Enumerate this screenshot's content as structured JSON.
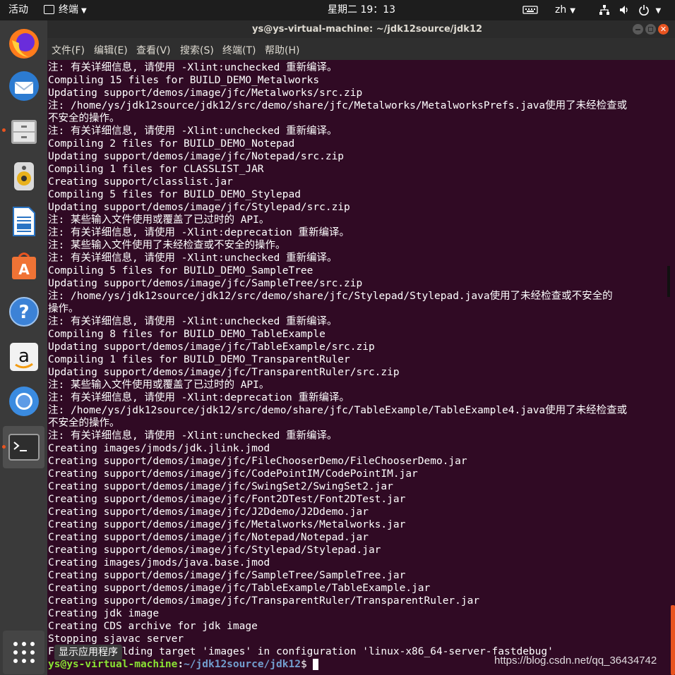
{
  "topbar": {
    "activities": "活动",
    "app_menu": "终端",
    "clock": "星期二 19：13",
    "lang": "zh"
  },
  "dock": {
    "show_apps_tooltip": "显示应用程序",
    "items": [
      "firefox-icon",
      "thunderbird-icon",
      "files-icon",
      "rhythmbox-icon",
      "libreoffice-writer-icon",
      "software-center-icon",
      "help-icon",
      "amazon-icon",
      "chromium-icon",
      "terminal-icon"
    ]
  },
  "window": {
    "title": "ys@ys-virtual-machine: ~/jdk12source/jdk12"
  },
  "menubar": [
    "文件(F)",
    "编辑(E)",
    "查看(V)",
    "搜索(S)",
    "终端(T)",
    "帮助(H)"
  ],
  "terminal": {
    "lines": [
      "注: 有关详细信息, 请使用 -Xlint:unchecked 重新编译。",
      "Compiling 15 files for BUILD_DEMO_Metalworks",
      "Updating support/demos/image/jfc/Metalworks/src.zip",
      "注: /home/ys/jdk12source/jdk12/src/demo/share/jfc/Metalworks/MetalworksPrefs.java使用了未经检查或",
      "不安全的操作。",
      "注: 有关详细信息, 请使用 -Xlint:unchecked 重新编译。",
      "Compiling 2 files for BUILD_DEMO_Notepad",
      "Updating support/demos/image/jfc/Notepad/src.zip",
      "Compiling 1 files for CLASSLIST_JAR",
      "Creating support/classlist.jar",
      "Compiling 5 files for BUILD_DEMO_Stylepad",
      "Updating support/demos/image/jfc/Stylepad/src.zip",
      "注: 某些输入文件使用或覆盖了已过时的 API。",
      "注: 有关详细信息, 请使用 -Xlint:deprecation 重新编译。",
      "注: 某些输入文件使用了未经检查或不安全的操作。",
      "注: 有关详细信息, 请使用 -Xlint:unchecked 重新编译。",
      "Compiling 5 files for BUILD_DEMO_SampleTree",
      "Updating support/demos/image/jfc/SampleTree/src.zip",
      "注: /home/ys/jdk12source/jdk12/src/demo/share/jfc/Stylepad/Stylepad.java使用了未经检查或不安全的",
      "操作。",
      "注: 有关详细信息, 请使用 -Xlint:unchecked 重新编译。",
      "Compiling 8 files for BUILD_DEMO_TableExample",
      "Updating support/demos/image/jfc/TableExample/src.zip",
      "Compiling 1 files for BUILD_DEMO_TransparentRuler",
      "Updating support/demos/image/jfc/TransparentRuler/src.zip",
      "注: 某些输入文件使用或覆盖了已过时的 API。",
      "注: 有关详细信息, 请使用 -Xlint:deprecation 重新编译。",
      "注: /home/ys/jdk12source/jdk12/src/demo/share/jfc/TableExample/TableExample4.java使用了未经检查或",
      "不安全的操作。",
      "注: 有关详细信息, 请使用 -Xlint:unchecked 重新编译。",
      "Creating images/jmods/jdk.jlink.jmod",
      "Creating support/demos/image/jfc/FileChooserDemo/FileChooserDemo.jar",
      "Creating support/demos/image/jfc/CodePointIM/CodePointIM.jar",
      "Creating support/demos/image/jfc/SwingSet2/SwingSet2.jar",
      "Creating support/demos/image/jfc/Font2DTest/Font2DTest.jar",
      "Creating support/demos/image/jfc/J2Ddemo/J2Ddemo.jar",
      "Creating support/demos/image/jfc/Metalworks/Metalworks.jar",
      "Creating support/demos/image/jfc/Notepad/Notepad.jar",
      "Creating support/demos/image/jfc/Stylepad/Stylepad.jar",
      "Creating images/jmods/java.base.jmod",
      "Creating support/demos/image/jfc/SampleTree/SampleTree.jar",
      "Creating support/demos/image/jfc/TableExample/TableExample.jar",
      "Creating support/demos/image/jfc/TransparentRuler/TransparentRuler.jar",
      "Creating jdk image",
      "Creating CDS archive for jdk image",
      "Stopping sjavac server",
      "Finished building target 'images' in configuration 'linux-x86_64-server-fastdebug'"
    ],
    "prompt_user": "ys@ys-virtual-machine",
    "prompt_colon": ":",
    "prompt_path": "~/jdk12source/jdk12",
    "prompt_symbol": "$ "
  },
  "watermark": "https://blog.csdn.net/qq_36434742",
  "colors": {
    "terminal_bg": "#300a24",
    "prompt_user": "#8ae234",
    "prompt_path": "#729fcf",
    "accent": "#e95420"
  }
}
